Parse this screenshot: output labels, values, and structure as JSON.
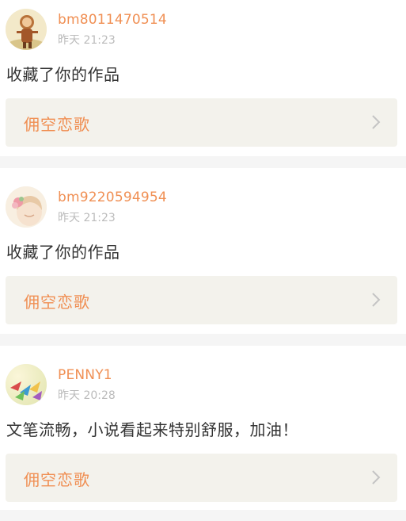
{
  "feed": {
    "items": [
      {
        "username": "bm8011470514",
        "time": "昨天 21:23",
        "message": "收藏了你的作品",
        "work_title": "佣空恋歌",
        "avatar_icon": "cartoon-character-avatar"
      },
      {
        "username": "bm9220594954",
        "time": "昨天 21:23",
        "message": "收藏了你的作品",
        "work_title": "佣空恋歌",
        "avatar_icon": "flower-girl-avatar"
      },
      {
        "username": "PENNY1",
        "time": "昨天 20:28",
        "message": "文笔流畅，小说看起来特别舒服，加油！",
        "work_title": "佣空恋歌",
        "avatar_icon": "paper-cranes-avatar"
      }
    ]
  },
  "colors": {
    "accent": "#f08f53",
    "card_bg": "#ffffff",
    "page_bg": "#f5f5f5",
    "work_bg": "#f3f2ec",
    "time": "#bbbbbb",
    "text": "#333333"
  }
}
